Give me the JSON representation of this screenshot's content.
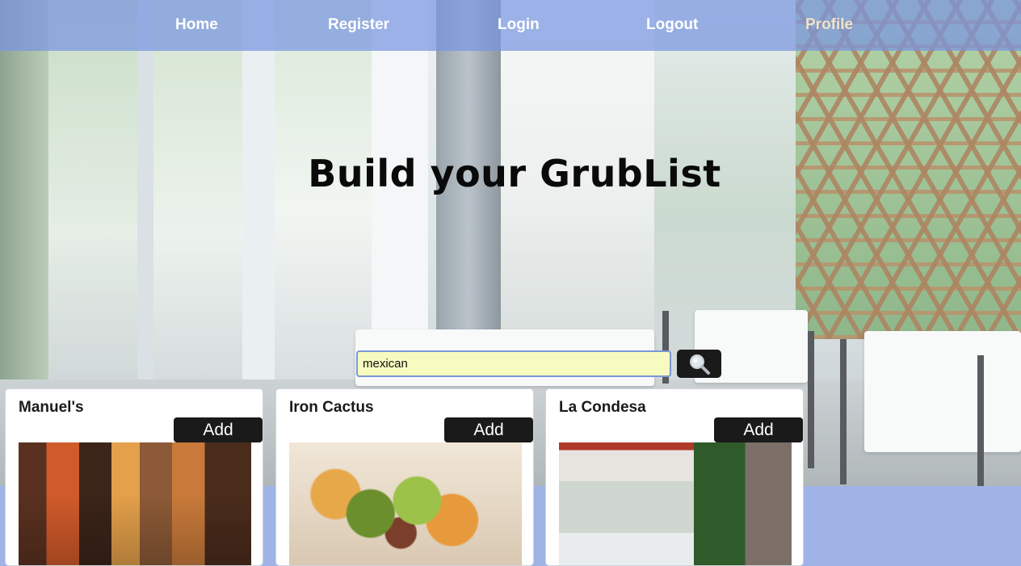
{
  "nav": {
    "items": [
      "Home",
      "Register",
      "Login",
      "Logout",
      "Profile"
    ]
  },
  "hero": {
    "title": "Build your GrubList"
  },
  "search": {
    "value": "mexican",
    "button_icon": "search-icon"
  },
  "restaurants": [
    {
      "name": "Manuel's",
      "add_label": "Add",
      "image": "restaurant-interior-photo"
    },
    {
      "name": "Iron Cactus",
      "add_label": "Add",
      "image": "taco-salad-photo"
    },
    {
      "name": "La Condesa",
      "add_label": "Add",
      "image": "restaurant-entrance-photo"
    }
  ],
  "colors": {
    "nav_bg": "#7896e1",
    "accent_dark": "#1a1a1a",
    "search_bg": "#f8fbbf",
    "page_bg": "#9fb3e6"
  }
}
